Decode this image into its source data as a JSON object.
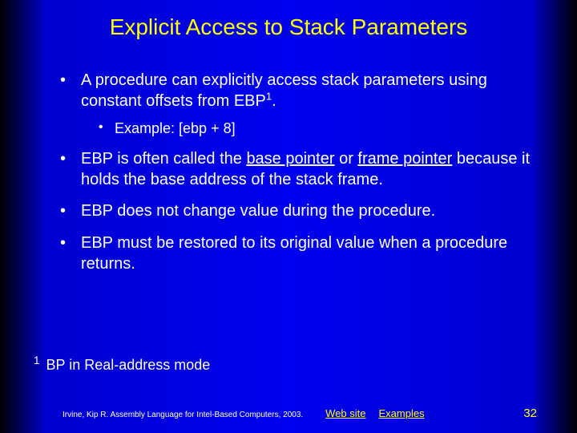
{
  "title": "Explicit Access to Stack Parameters",
  "bullets": {
    "b1_pre": "A procedure can explicitly access stack parameters using constant offsets from EBP",
    "b1_sup": "1",
    "b1_post": ".",
    "b1_example": "Example: [ebp + 8]",
    "b2_pre": "EBP is often called the ",
    "b2_u1": "base pointer",
    "b2_mid": " or ",
    "b2_u2": "frame pointer",
    "b2_post": " because it holds the base address of the stack frame.",
    "b3": "EBP does not change value during the procedure.",
    "b4": "EBP must be restored to its original value when a procedure returns."
  },
  "footnote": {
    "marker": "1",
    "text": " BP in Real-address mode"
  },
  "footer": {
    "citation": "Irvine, Kip R. Assembly Language for Intel-Based Computers, 2003.",
    "link1": "Web site",
    "link2": "Examples",
    "page": "32"
  }
}
